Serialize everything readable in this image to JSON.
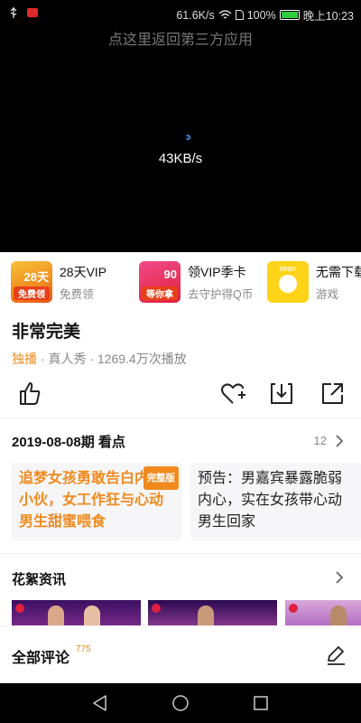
{
  "status_bar": {
    "speed": "61.6K/s",
    "battery": "100%",
    "time": "晚上10:23"
  },
  "video": {
    "back_hint": "点这里返回第三方应用",
    "load_speed": "43KB/s"
  },
  "promos": [
    {
      "title": "28天VIP",
      "subtitle": "免费领",
      "thumb_num": "28天",
      "thumb_badge": "免费领"
    },
    {
      "title": "领VIP季卡",
      "subtitle": "去守护得Q币",
      "thumb_num": "90",
      "thumb_badge": "等你拿"
    },
    {
      "title": "无需下载",
      "subtitle": "游戏",
      "thumb_num": "iwan",
      "thumb_badge": ""
    }
  ],
  "show": {
    "title": "非常完美",
    "exclusive": "独播",
    "meta_rest": " · 真人秀 · 1269.4万次播放"
  },
  "episode": {
    "period_label": "2019-08-08期 看点",
    "count": "12"
  },
  "cards": [
    {
      "text": "追梦女孩勇敢告白内向小伙，女工作狂与心动男生甜蜜喂食",
      "tag": "完整版"
    },
    {
      "text": "预告：男嘉宾暴露脆弱内心，实在女孩带心动男生回家",
      "tag": ""
    }
  ],
  "huaxu": {
    "title": "花絮资讯"
  },
  "comments": {
    "title": "全部评论",
    "count": "775"
  },
  "colors": {
    "accent": "#f08a1e",
    "video_bg": "#000000"
  },
  "icons": [
    "like-icon",
    "favorite-add-icon",
    "download-icon",
    "share-icon",
    "chevron-right-icon",
    "edit-pen-icon",
    "nav-back-icon",
    "nav-home-icon",
    "nav-recent-icon"
  ]
}
